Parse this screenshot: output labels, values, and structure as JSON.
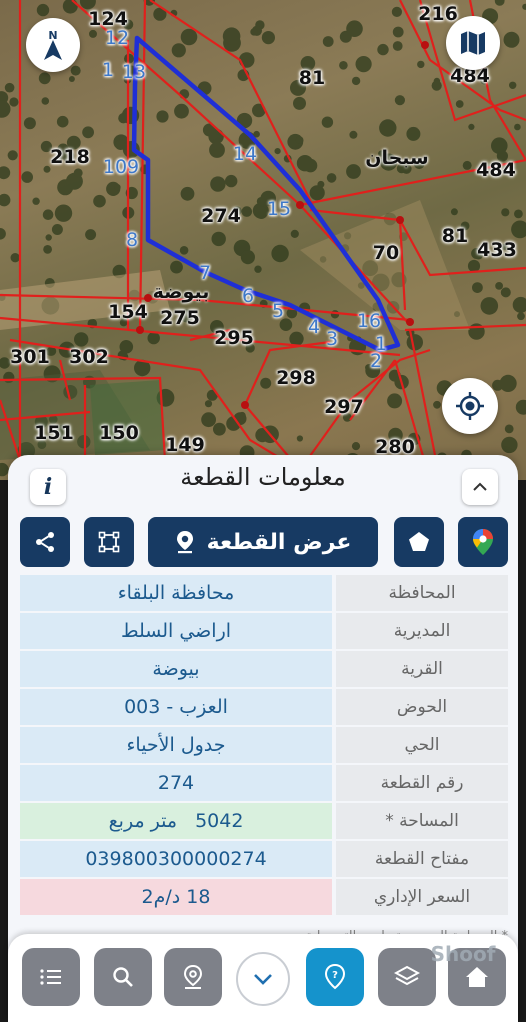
{
  "map": {
    "parcel_labels": [
      "124",
      "216",
      "484",
      "81",
      "484",
      "218",
      "274",
      "81",
      "433",
      "70",
      "154",
      "275",
      "295",
      "301",
      "302",
      "298",
      "297",
      "151",
      "150",
      "149",
      "280"
    ],
    "vertex_labels": [
      "12",
      "1",
      "13",
      "14",
      "109",
      "15",
      "8",
      "7",
      "6",
      "5",
      "4",
      "3",
      "16",
      "1",
      "2"
    ],
    "place_labels": [
      "سبحان",
      "بيوضة"
    ],
    "compass_icon": "north-arrow-icon",
    "layers_icon": "map-icon",
    "locate_icon": "gps-target-icon",
    "colors": {
      "boundary": "#e0201c",
      "selected_parcel": "#1f2fd6",
      "vertex_text": "#3e78c8"
    }
  },
  "panel": {
    "title": "معلومات القطعة",
    "info_label": "i",
    "collapse_icon": "chevron-up-icon",
    "actions": {
      "share_icon": "share-icon",
      "draw_icon": "polygon-select-icon",
      "view_label": "عرض القطعة",
      "view_icon": "location-pin-icon",
      "favorite_icon": "pentagon-star-icon",
      "maps_icon": "google-maps-pin-icon"
    },
    "rows": [
      {
        "label": "المحافظة",
        "value": "محافظة البلقاء"
      },
      {
        "label": "المديرية",
        "value": "اراضي السلط"
      },
      {
        "label": "القرية",
        "value": "بيوضة"
      },
      {
        "label": "الحوض",
        "value": "العزب - 003"
      },
      {
        "label": "الحي",
        "value": "جدول الأحياء"
      },
      {
        "label": "رقم القطعة",
        "value": "274"
      },
      {
        "label": "المساحة *",
        "value_number": "5042",
        "value_unit": "متر مربع"
      },
      {
        "label": "مفتاح القطعة",
        "value": "039800300000274"
      },
      {
        "label": "السعر الإداري",
        "value": "18 د/م2"
      }
    ],
    "note": "* المساحة المحسوبة وليس التسجيلية"
  },
  "bottom_nav": {
    "items": [
      "list-icon",
      "search-icon",
      "location-search-icon",
      "chevron-down-icon",
      "parcel-pin-icon",
      "layers-icon",
      "home-icon"
    ],
    "watermark": "Shoof"
  }
}
